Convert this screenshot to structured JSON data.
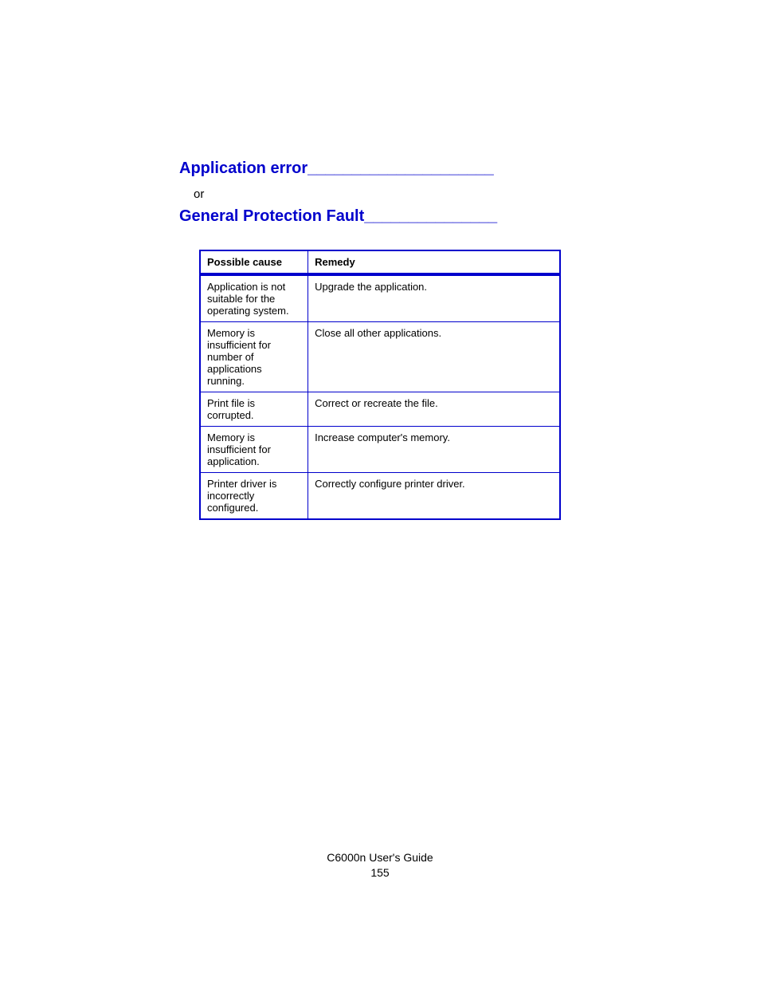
{
  "heading1": {
    "text": "Application error",
    "fill": "_____________________"
  },
  "or_text": "or",
  "heading2": {
    "text": "General Protection Fault",
    "fill": "_______________"
  },
  "table": {
    "headers": {
      "cause": "Possible cause",
      "remedy": "Remedy"
    },
    "rows": [
      {
        "cause": "Application is not suitable for the operating system.",
        "remedy": "Upgrade the application."
      },
      {
        "cause": "Memory is insufficient for number of applications running.",
        "remedy": "Close all other applications."
      },
      {
        "cause": "Print file is corrupted.",
        "remedy": "Correct or recreate the file."
      },
      {
        "cause": "Memory is insufficient for application.",
        "remedy": "Increase computer's memory."
      },
      {
        "cause": "Printer driver is incorrectly configured.",
        "remedy": "Correctly configure printer driver."
      }
    ]
  },
  "footer": {
    "guide": "C6000n User's Guide",
    "page": "155"
  }
}
